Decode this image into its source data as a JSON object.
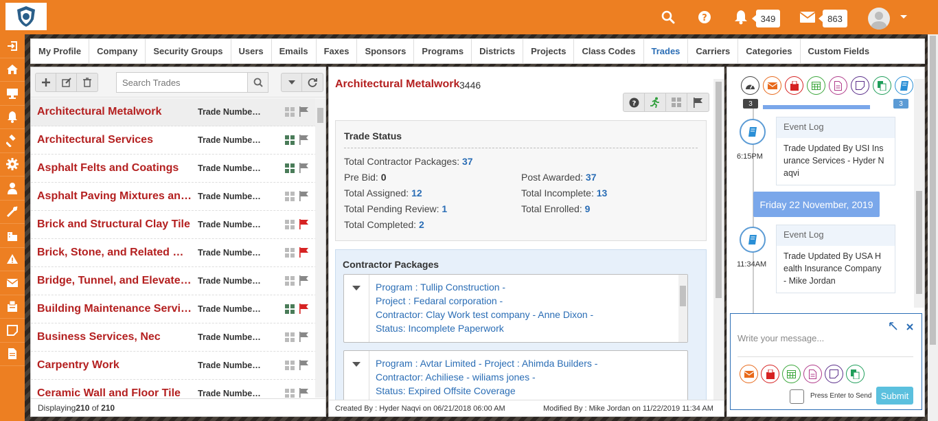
{
  "topbar": {
    "notifications_count": "349",
    "messages_count": "863"
  },
  "tabs": [
    {
      "label": "My Profile"
    },
    {
      "label": "Company"
    },
    {
      "label": "Security Groups"
    },
    {
      "label": "Users"
    },
    {
      "label": "Emails"
    },
    {
      "label": "Faxes"
    },
    {
      "label": "Sponsors"
    },
    {
      "label": "Programs"
    },
    {
      "label": "Districts"
    },
    {
      "label": "Projects"
    },
    {
      "label": "Class Codes"
    },
    {
      "label": "Trades"
    },
    {
      "label": "Carriers"
    },
    {
      "label": "Categories"
    },
    {
      "label": "Custom Fields"
    }
  ],
  "left": {
    "search_placeholder": "Search Trades",
    "rows": [
      {
        "name": "Architectural Metalwork",
        "number": "Trade Number...",
        "grid_active": false,
        "flag": "gray"
      },
      {
        "name": "Architectural Services",
        "number": "Trade Number...",
        "grid_active": true,
        "flag": "gray"
      },
      {
        "name": "Asphalt Felts and Coatings",
        "number": "Trade Number...",
        "grid_active": true,
        "flag": "gray"
      },
      {
        "name": "Asphalt Paving Mixtures and ...",
        "number": "Trade Number...",
        "grid_active": false,
        "flag": "gray"
      },
      {
        "name": "Brick and Structural Clay Tile",
        "number": "Trade Number...",
        "grid_active": false,
        "flag": "red"
      },
      {
        "name": "Brick, Stone, and Related Mat...",
        "number": "Trade Number...",
        "grid_active": false,
        "flag": "red"
      },
      {
        "name": "Bridge, Tunnel, and Elevated ...",
        "number": "Trade Number...",
        "grid_active": false,
        "flag": "gray"
      },
      {
        "name": "Building Maintenance Servic...",
        "number": "Trade Number...",
        "grid_active": true,
        "flag": "red"
      },
      {
        "name": "Business Services, Nec",
        "number": "Trade Number...",
        "grid_active": false,
        "flag": "gray"
      },
      {
        "name": "Carpentry Work",
        "number": "Trade Number...",
        "grid_active": false,
        "flag": "gray"
      },
      {
        "name": "Ceramic Wall and Floor Tile",
        "number": "Trade Number...",
        "grid_active": false,
        "flag": "gray"
      }
    ],
    "footer_prefix": "Displaying ",
    "footer_shown": "210",
    "footer_of": " of ",
    "footer_total": "210"
  },
  "detail": {
    "title": "Architectural Metalwork",
    "id": "3446",
    "status_title": "Trade Status",
    "stats": {
      "total_contractor_packages": {
        "label": "Total Contractor Packages: ",
        "value": "37"
      },
      "pre_bid": {
        "label": "Pre Bid: ",
        "value": "0"
      },
      "post_awarded": {
        "label": "Post Awarded: ",
        "value": "37"
      },
      "total_assigned": {
        "label": "Total Assigned: ",
        "value": "12"
      },
      "total_incomplete": {
        "label": "Total Incomplete: ",
        "value": "13"
      },
      "total_pending_review": {
        "label": "Total Pending Review: ",
        "value": "1"
      },
      "total_enrolled": {
        "label": "Total Enrolled: ",
        "value": "9"
      },
      "total_completed": {
        "label": "Total Completed: ",
        "value": "2"
      }
    },
    "packages_title": "Contractor Packages",
    "packages": [
      {
        "lines": [
          "Program : Tullip Construction -",
          "Project : Fedaral corporation -",
          "Contractor: Clay Work test company - Anne Dixon -",
          "Status: Incomplete Paperwork"
        ]
      },
      {
        "lines": [
          "Program : Avtar Limited -  Project : Ahimda Builders -",
          "Contractor: Achiliese - wiliams jones -",
          "Status: Expired Offsite Coverage"
        ]
      }
    ],
    "created_by": "Created By : Hyder Naqvi on 06/21/2018 06:00 AM",
    "modified_by": "Modified By : Mike Jordan on 11/22/2019 11:34 AM"
  },
  "activity": {
    "badge_left": "3",
    "badge_right": "3",
    "events": [
      {
        "time": "6:15PM",
        "title": "Event Log",
        "lines": [
          "Trade Updated By USI Ins",
          "urance Services - Hyder N",
          "aqvi"
        ]
      },
      {
        "time": "11:34AM",
        "title": "Event Log",
        "lines": [
          "Trade Updated By USA H",
          "ealth Insurance Company",
          "- Mike Jordan"
        ]
      }
    ],
    "date": "Friday 22 November, 2019",
    "message_placeholder": "Write your message...",
    "enter_label": "Press Enter to Send",
    "submit_label": "Submit"
  },
  "colors": {
    "brand_orange": "#ed7f22",
    "trade_red": "#b42020",
    "link_blue": "#2a6db5"
  }
}
